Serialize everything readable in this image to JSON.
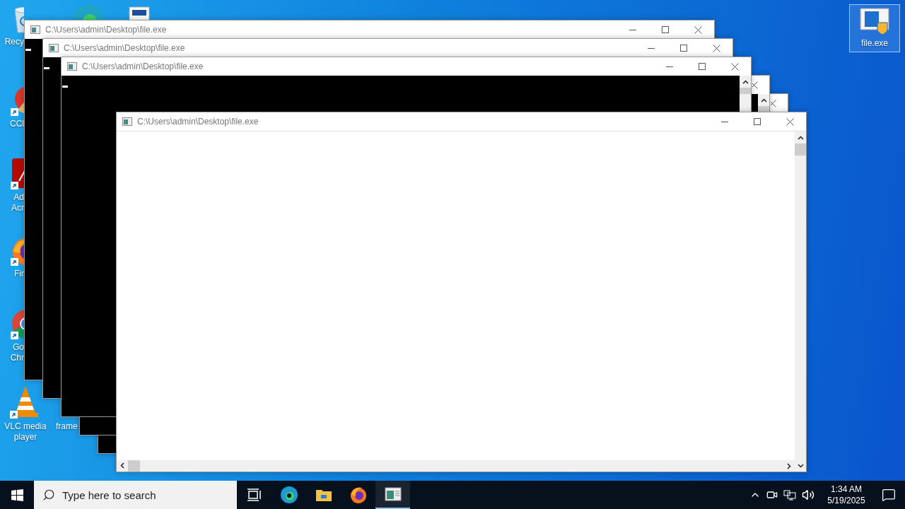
{
  "desktop_icons": [
    {
      "kind": "recycle",
      "lines": [
        "Recy"
      ],
      "selected": false
    },
    {
      "kind": "edge",
      "selected": false
    },
    {
      "kind": "document",
      "selected": false
    },
    {
      "kind": "ccleaner",
      "lines": [
        "CCl"
      ],
      "selected": false
    },
    {
      "kind": "acrobat",
      "lines": [
        "Ad",
        "Acr"
      ],
      "selected": false
    },
    {
      "kind": "firefox",
      "lines": [
        "Fir"
      ],
      "selected": false
    },
    {
      "kind": "chrome",
      "lines": [
        "Go",
        "Chr"
      ],
      "selected": false
    },
    {
      "kind": "vlc",
      "lines": [
        "VLC media",
        "player"
      ],
      "selected": false
    },
    {
      "kind": "hidden",
      "lines": [
        "frame"
      ],
      "selected": false
    },
    {
      "kind": "app",
      "lines": [
        "file.exe"
      ],
      "selected": true
    }
  ],
  "windows": [
    {
      "kind": "console",
      "title": "C:\\Users\\admin\\Desktop\\file.exe"
    },
    {
      "kind": "console",
      "title": "C:\\Users\\admin\\Desktop\\file.exe"
    },
    {
      "kind": "console"
    },
    {
      "kind": "console",
      "scrollbar": true
    },
    {
      "kind": "console",
      "title": "C:\\Users\\admin\\Desktop\\file.exe",
      "scrollbar": true
    },
    {
      "kind": "gui",
      "title": "C:\\Users\\admin\\Desktop\\file.exe"
    }
  ],
  "taskbar": {
    "search": {
      "placeholder": "Type here to search"
    },
    "apps": [
      {
        "kind": "taskview",
        "active": false
      },
      {
        "kind": "edge",
        "active": false
      },
      {
        "kind": "explorer",
        "active": false
      },
      {
        "kind": "firefox",
        "active": false
      },
      {
        "kind": "console",
        "active": true
      }
    ],
    "clock": {
      "time": "1:34 AM",
      "date": "5/19/2025"
    }
  }
}
